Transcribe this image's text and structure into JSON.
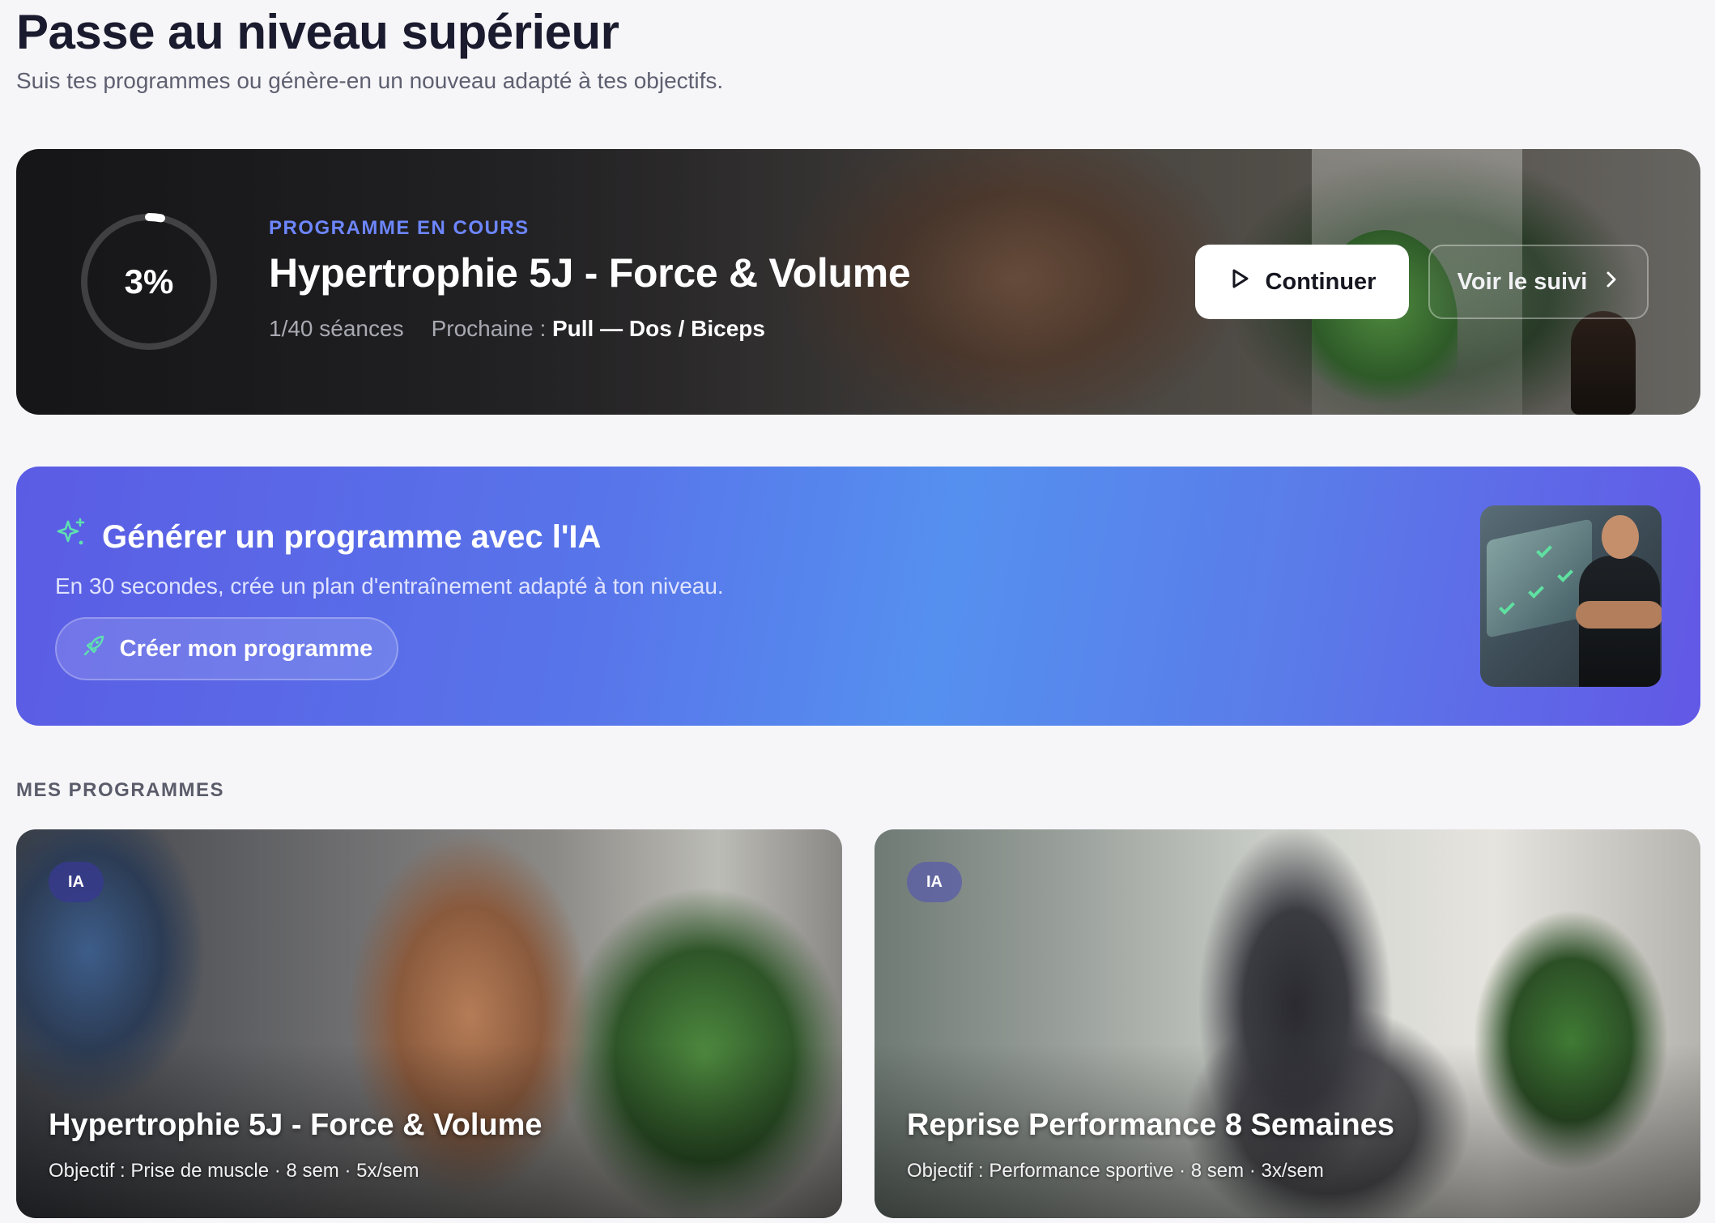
{
  "header": {
    "title": "Passe au niveau supérieur",
    "subtitle": "Suis tes programmes ou génère-en un nouveau adapté à tes objectifs."
  },
  "current_program": {
    "progress_label": "3%",
    "progress_fraction": 0.03,
    "eyebrow": "PROGRAMME EN COURS",
    "title": "Hypertrophie 5J - Force & Volume",
    "sessions": "1/40 séances",
    "next_label": "Prochaine :",
    "next_value": "Pull — Dos / Biceps",
    "continue_label": "Continuer",
    "follow_label": "Voir le suivi",
    "accent_color": "#6d86ff"
  },
  "ai_banner": {
    "title": "Générer un programme avec l'IA",
    "subtitle": "En 30 secondes, crée un plan d'entraînement adapté à ton niveau.",
    "button_label": "Créer mon programme",
    "icon": "sparkles-icon",
    "button_icon": "rocket-icon",
    "icon_color": "#5fe0b0"
  },
  "my_programs": {
    "section_label": "MES PROGRAMMES",
    "items": [
      {
        "badge": "IA",
        "title": "Hypertrophie 5J - Force & Volume",
        "meta": "Objectif : Prise de muscle · 8 sem · 5x/sem"
      },
      {
        "badge": "IA",
        "title": "Reprise Performance 8 Semaines",
        "meta": "Objectif : Performance sportive · 8 sem · 3x/sem"
      }
    ]
  }
}
